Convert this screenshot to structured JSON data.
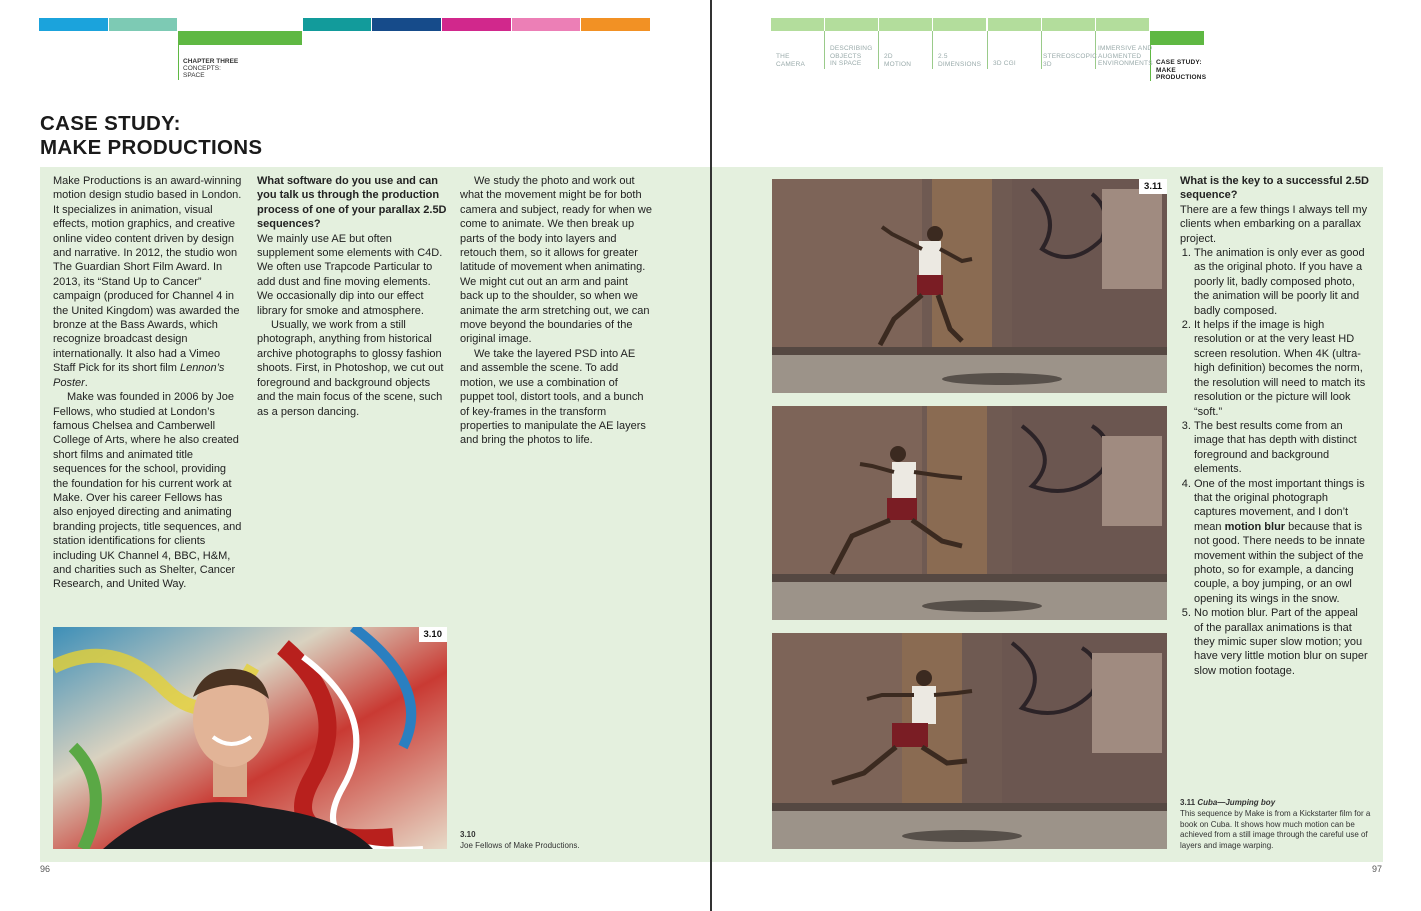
{
  "colors": {
    "page_bg": "#ffffff",
    "panel_bg": "#e4f0de",
    "nav_green": "#6bbf4a",
    "nav_green_light": "#b3dd9c",
    "chapter_bars": [
      "#1ba3dc",
      "#7dcab4",
      "#5fb843",
      "#129b9b",
      "#164b8a",
      "#d1288c",
      "#ec7fb6",
      "#f29124"
    ]
  },
  "left_nav": {
    "chapter": "CHAPTER THREE",
    "subtitle_line1": "CONCEPTS:",
    "subtitle_line2": "SPACE"
  },
  "right_nav": {
    "sections": [
      {
        "line1": "THE",
        "line2": "CAMERA",
        "line3": ""
      },
      {
        "line1": "DESCRIBING",
        "line2": "OBJECTS",
        "line3": "IN SPACE"
      },
      {
        "line1": "2D",
        "line2": "MOTION",
        "line3": ""
      },
      {
        "line1": "2.5",
        "line2": "DIMENSIONS",
        "line3": ""
      },
      {
        "line1": "3D CGI",
        "line2": "",
        "line3": ""
      },
      {
        "line1": "STEREOSCOPIC",
        "line2": "3D",
        "line3": ""
      },
      {
        "line1": "IMMERSIVE AND",
        "line2": "AUGMENTED",
        "line3": "ENVIRONMENTS"
      }
    ],
    "active": {
      "line1": "CASE STUDY:",
      "line2": "MAKE",
      "line3": "PRODUCTIONS"
    }
  },
  "title": {
    "line1": "CASE STUDY:",
    "line2": "MAKE PRODUCTIONS"
  },
  "col1": {
    "p1_pre": "Make Productions is an award-winning motion design studio based in London. It specializes in animation, visual effects, motion graphics, and creative online video content driven by design and narrative. In 2012, the studio won The Guardian Short Film Award. In 2013, its “Stand Up to Cancer” campaign (produced for Channel 4 in the United Kingdom) was awarded the bronze at the Bass Awards, which recognize broadcast design internationally. It also had a Vimeo Staff Pick for its short film ",
    "p1_italic": "Lennon’s Poster",
    "p1_post": ".",
    "p2": "Make was founded in 2006 by Joe Fellows, who studied at London’s famous Chelsea and Camberwell College of Arts, where he also created short films and animated title sequences for the school, providing the foundation for his current work at Make. Over his career Fellows has also enjoyed directing and animating branding projects, title sequences, and station identifications for clients including UK Channel 4, BBC, H&M, and charities such as Shelter, Cancer Research, and United Way."
  },
  "col2": {
    "question": "What software do you use and can you talk us through the production process of one of your parallax 2.5D sequences?",
    "p1": "We mainly use AE but often supplement some elements with C4D. We often use Trapcode Particular to add dust and fine moving elements. We occasionally dip into our effect library for smoke and atmosphere.",
    "p2": "Usually, we work from a still photograph, anything from historical archive photographs to glossy fashion shoots. First, in Photoshop, we cut out foreground and background objects and the main focus of the scene, such as a person dancing."
  },
  "col3": {
    "p1": "We study the photo and work out what the movement might be for both camera and subject, ready for when we come to animate. We then break up parts of the body into layers and retouch them, so it allows for greater latitude of movement when animating. We might cut out an arm and paint back up to the shoulder, so when we animate the arm stretching out, we can move beyond the boundaries of the original image.",
    "p2": "We take the layered PSD into AE and assemble the scene. To add motion, we use a combination of puppet tool, distort tools, and a bunch of key-frames in the transform properties to manipulate the AE layers and bring the photos to life."
  },
  "col4": {
    "question": "What is the key to a successful 2.5D sequence?",
    "intro": "There are a few things I always tell my clients when embarking on a parallax project.",
    "items": [
      "The animation is only ever as good as the original photo. If you have a poorly lit, badly composed photo, the animation will be poorly lit and badly composed.",
      "It helps if the image is high resolution or at the very least HD screen resolution. When 4K (ultra-high definition) becomes the norm, the resolution will need to match its resolution or the picture will look “soft.”",
      "The best results come from an image that has depth with distinct foreground and background elements."
    ],
    "item4_pre": "One of the most important things is that the original photograph captures movement, and I don’t mean ",
    "item4_bold": "motion blur",
    "item4_post": " because that is not good. There needs to be innate movement within the subject of the photo, so for example, a dancing couple, a boy jumping, or an owl opening its wings in the snow.",
    "item5": "No motion blur. Part of the appeal of the parallax animations is that they mimic super slow motion; you have very little motion blur on super slow motion footage."
  },
  "figure_310": {
    "tag": "3.10",
    "caption_num": "3.10",
    "caption": "Joe Fellows of Make Productions."
  },
  "figure_311": {
    "tag": "3.11",
    "caption_num": "3.11 ",
    "caption_title": "Cuba—Jumping boy",
    "caption": "This sequence by Make is from a Kickstarter film for a book on Cuba. It shows how much motion can be achieved from a still image through the careful use of layers and image warping."
  },
  "page_numbers": {
    "left": "96",
    "right": "97"
  }
}
